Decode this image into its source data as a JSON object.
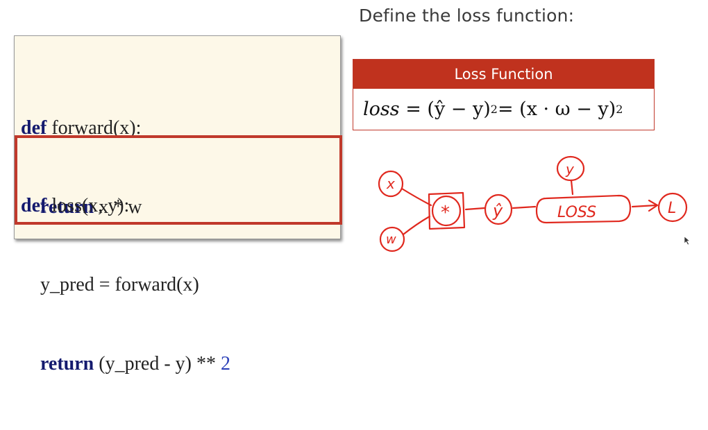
{
  "heading": "Define the loss function:",
  "code": {
    "forward_def": [
      "def",
      " forward(x):"
    ],
    "forward_return": [
      "return",
      " x * w"
    ],
    "loss_def": [
      "def",
      " loss(x, y):"
    ],
    "loss_pred": "y_pred = forward(x)",
    "loss_return": [
      "return",
      " (y_pred - y) ** ",
      "2"
    ]
  },
  "loss_box": {
    "title": "Loss Function",
    "equation": {
      "lhs": "loss",
      "mid": "= (ŷ − y)",
      "sup1": "2",
      "rhs": "= (x · ω − y)",
      "sup2": "2"
    }
  },
  "diagram": {
    "nodes": {
      "x": "x",
      "w": "w",
      "mul": "*",
      "yhat": "ŷ",
      "y": "y",
      "loss": "LOSS",
      "L": "L"
    },
    "stroke_color": "#e0281e"
  }
}
